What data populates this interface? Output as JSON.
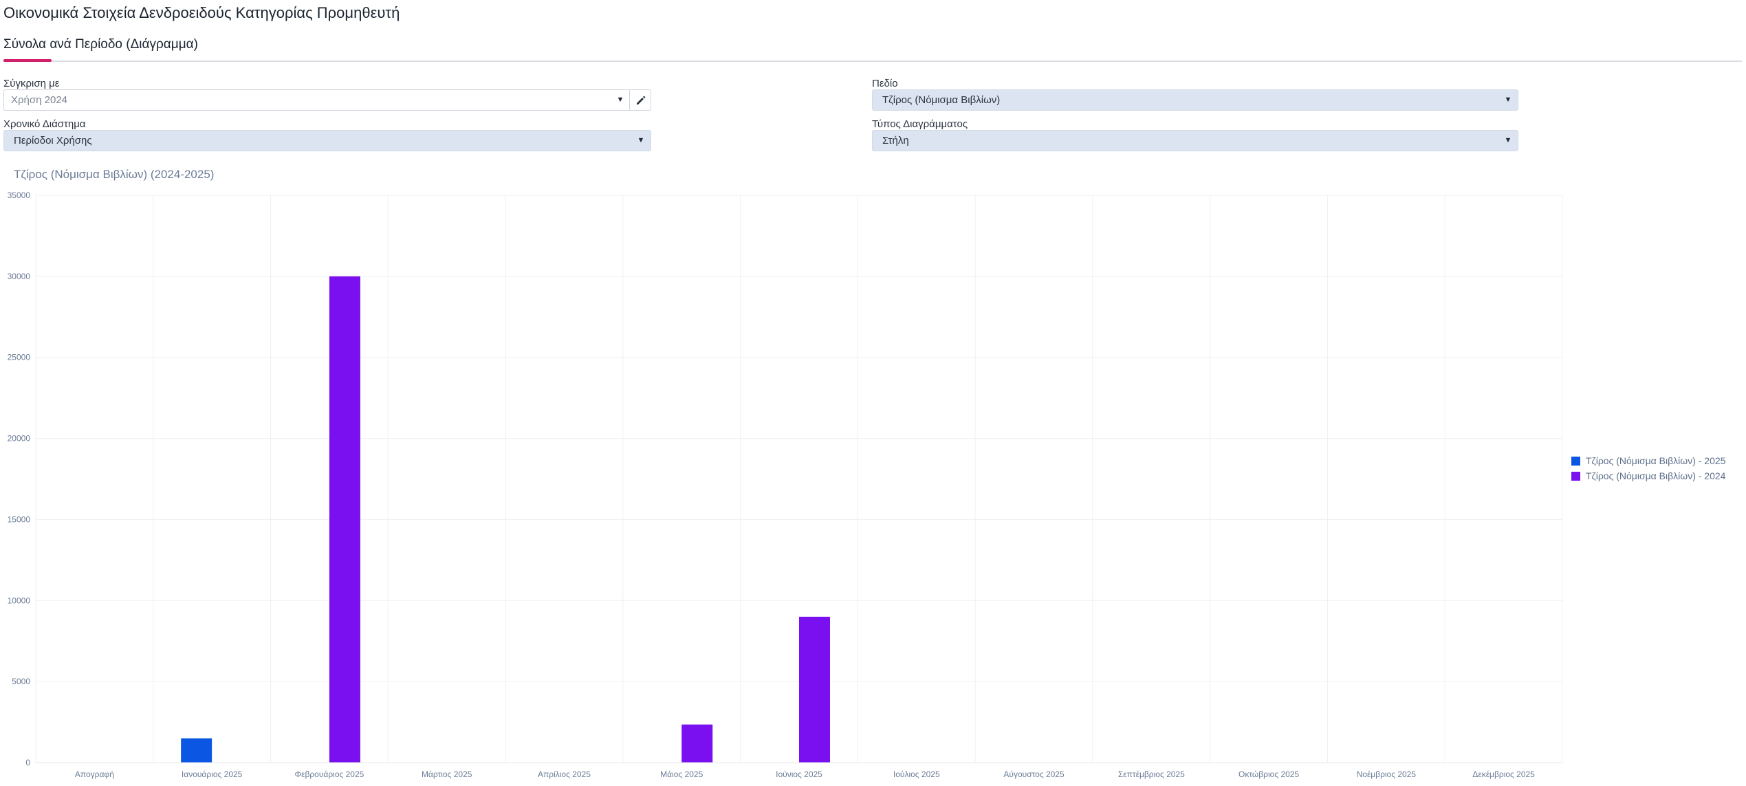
{
  "page": {
    "title": "Οικονομικά Στοιχεία Δενδροειδούς Κατηγορίας Προμηθευτή",
    "active_tab": "Σύνολα ανά Περίοδο (Διάγραμμα)"
  },
  "filters": {
    "compare_label": "Σύγκριση με",
    "compare_value": "Χρήση 2024",
    "field_label": "Πεδίο",
    "field_value": "Τζίρος (Νόμισμα Βιβλίων)",
    "interval_label": "Χρονικό Διάστημα",
    "interval_value": "Περίοδοι Χρήσης",
    "chart_type_label": "Τύπος Διαγράμματος",
    "chart_type_value": "Στήλη"
  },
  "icons": {
    "dropdown": "chevron-down-icon",
    "edit": "pencil-icon"
  },
  "chart_data": {
    "type": "bar",
    "title": "Τζίρος (Νόμισμα Βιβλίων) (2024-2025)",
    "categories": [
      "Απογραφή",
      "Ιανουάριος 2025",
      "Φεβρουάριος 2025",
      "Μάρτιος 2025",
      "Απρίλιος 2025",
      "Μάιος 2025",
      "Ιούνιος 2025",
      "Ιούλιος 2025",
      "Αύγουστος 2025",
      "Σεπτέμβριος 2025",
      "Οκτώβριος 2025",
      "Νοέμβριος 2025",
      "Δεκέμβριος 2025"
    ],
    "series": [
      {
        "name": "Τζίρος (Νόμισμα Βιβλίων) - 2025",
        "color": "#0b57e3",
        "values": [
          0,
          1500,
          0,
          0,
          0,
          0,
          0,
          0,
          0,
          0,
          0,
          0,
          0
        ]
      },
      {
        "name": "Τζίρος (Νόμισμα Βιβλίων) - 2024",
        "color": "#7a0ff0",
        "values": [
          0,
          0,
          30000,
          0,
          0,
          2350,
          9000,
          0,
          0,
          0,
          0,
          0,
          0
        ]
      }
    ],
    "ylim": [
      0,
      35000
    ],
    "yticks": [
      0,
      5000,
      10000,
      15000,
      20000,
      25000,
      30000,
      35000
    ],
    "grid": true,
    "legend_position": "right"
  }
}
